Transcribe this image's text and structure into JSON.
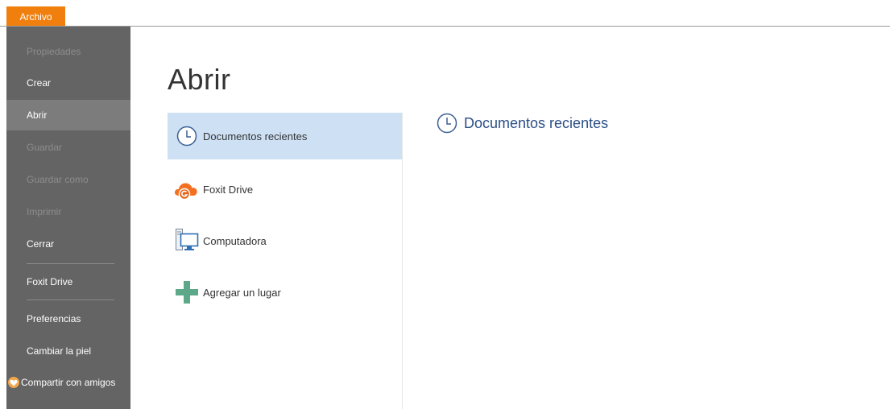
{
  "topbar": {
    "file_tab_label": "Archivo"
  },
  "sidebar": {
    "items": [
      {
        "label": "Propiedades"
      },
      {
        "label": "Crear"
      },
      {
        "label": "Abrir"
      },
      {
        "label": "Guardar"
      },
      {
        "label": "Guardar como"
      },
      {
        "label": "Imprimir"
      },
      {
        "label": "Cerrar"
      },
      {
        "label": "Foxit Drive"
      },
      {
        "label": "Preferencias"
      },
      {
        "label": "Cambiar la piel"
      },
      {
        "label": "Compartir con amigos"
      }
    ]
  },
  "main": {
    "title": "Abrir",
    "places": [
      {
        "label": "Documentos recientes",
        "icon": "clock-icon"
      },
      {
        "label": "Foxit Drive",
        "icon": "foxit-drive-cloud-icon"
      },
      {
        "label": "Computadora",
        "icon": "computer-icon"
      },
      {
        "label": "Agregar un lugar",
        "icon": "plus-icon"
      }
    ],
    "detail_title": "Documentos recientes"
  },
  "colors": {
    "accent_orange": "#f07f0e",
    "sidebar_bg": "#646464",
    "selected_bg": "#cde0f4",
    "heading_blue": "#2b4f87"
  }
}
